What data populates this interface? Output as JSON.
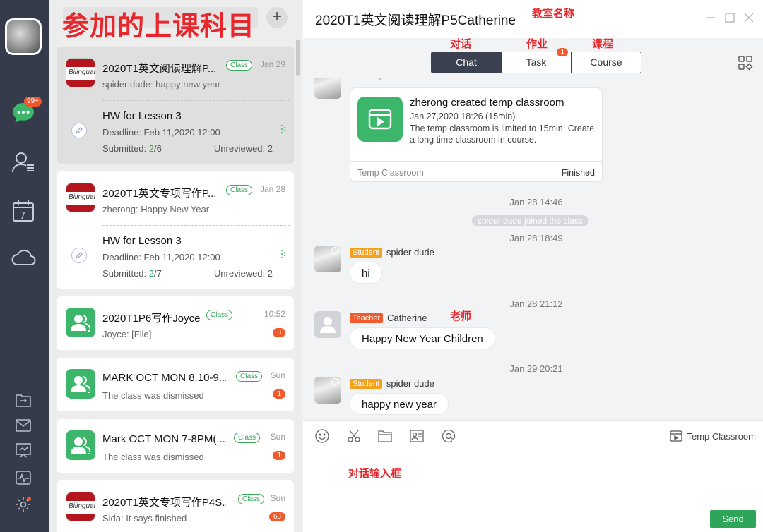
{
  "annotations": {
    "subjects": "参加的上课科目",
    "classroom_name": "教室名称",
    "chat": "对话",
    "task": "作业",
    "course": "课程",
    "teacher": "老师",
    "input_box": "对话输入框"
  },
  "rail": {
    "chat_badge": "99+"
  },
  "list": {
    "add_label": "+",
    "conversations": [
      {
        "logo": "Bilingual",
        "title": "2020T1英文阅读理解P...",
        "tag": "Class",
        "time": "Jan 29",
        "subtitle": "spider dude: happy new year",
        "hw": {
          "title": "HW for Lesson 3",
          "deadline": "Deadline: Feb 11,2020 12:00",
          "submitted_label": "Submitted: ",
          "submitted_count": "2",
          "submitted_total": "/6",
          "unreviewed": "Unreviewed: 2"
        }
      },
      {
        "logo": "Bilingual",
        "title": "2020T1英文专项写作P...",
        "tag": "Class",
        "time": "Jan 28",
        "subtitle": "zherong: Happy New Year",
        "hw": {
          "title": "HW for Lesson 3",
          "deadline": "Deadline: Feb 11,2020 12:00",
          "submitted_label": "Submitted: ",
          "submitted_count": "2",
          "submitted_total": "/7",
          "unreviewed": "Unreviewed: 2"
        }
      },
      {
        "title": "2020T1P6写作Joyce",
        "tag": "Class",
        "time": "10:52",
        "subtitle": "Joyce: [File]",
        "count": "3"
      },
      {
        "title": "MARK OCT MON 8.10-9...",
        "tag": "Class",
        "time": "Sun",
        "subtitle": "The class was dismissed",
        "count": "1"
      },
      {
        "title": "Mark OCT MON 7-8PM(...",
        "tag": "Class",
        "time": "Sun",
        "subtitle": "The class was dismissed",
        "count": "1"
      },
      {
        "logo": "Bilingual",
        "title": "2020T1英文专项写作P4S...",
        "tag": "Class",
        "time": "Sun",
        "subtitle": "Sida: It says finished",
        "count": "63"
      }
    ]
  },
  "chat": {
    "title": "2020T1英文阅读理解P5Catherine",
    "tabs": [
      "Chat",
      "Task",
      "Course"
    ],
    "task_badge": "1",
    "top_name": "zherong",
    "temp_card": {
      "title": "zherong created temp classroom",
      "date": "Jan 27,2020 18:26  (15min)",
      "desc": "The temp classroom is limited to 15min; Create a long time classroom in course.",
      "foot_left": "Temp Classroom",
      "foot_right": "Finished"
    },
    "t1": "Jan 28 14:46",
    "sys": "spider dude joined the class",
    "t2": "Jan 28 18:49",
    "m1": {
      "role": "Student",
      "name": "spider dude",
      "text": "hi"
    },
    "t3": "Jan 28 21:12",
    "m2": {
      "role": "Teacher",
      "name": "Catherine",
      "text": "Happy New Year Children"
    },
    "t4": "Jan 29 20:21",
    "m3": {
      "role": "Student",
      "name": "spider dude",
      "text": "happy new year"
    }
  },
  "composer": {
    "temp_classroom": "Temp Classroom",
    "send": "Send"
  }
}
